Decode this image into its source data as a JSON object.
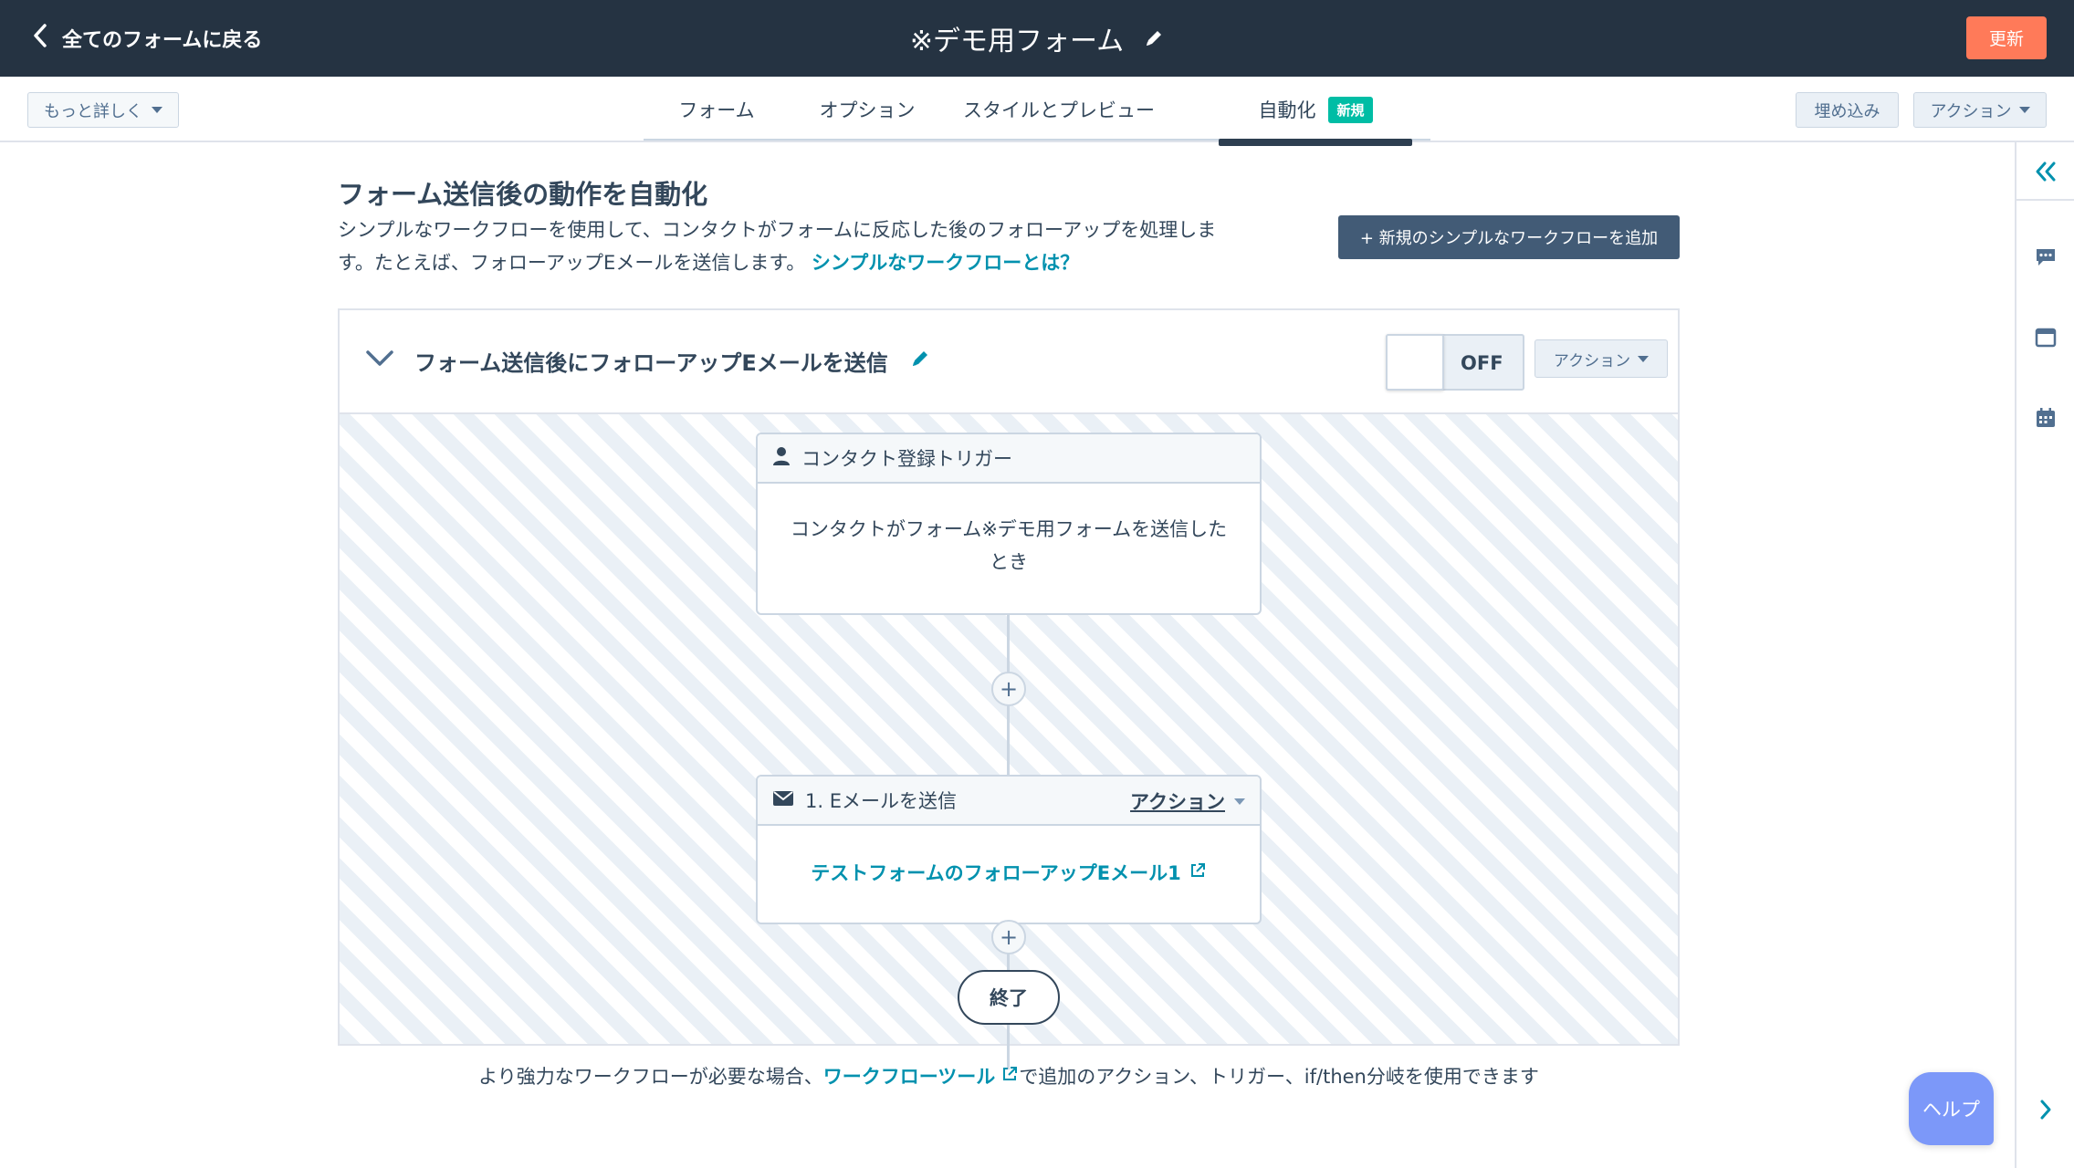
{
  "topbar": {
    "back_label": "全てのフォームに戻る",
    "form_title": "※デモ用フォーム",
    "update_label": "更新"
  },
  "navbar": {
    "more_label": "もっと詳しく",
    "tabs": [
      {
        "label": "フォーム"
      },
      {
        "label": "オプション"
      },
      {
        "label": "スタイルとプレビュー"
      },
      {
        "label": "自動化",
        "badge": "新規",
        "active": true
      }
    ],
    "embed_label": "埋め込み",
    "actions_label": "アクション"
  },
  "main": {
    "heading": "フォーム送信後の動作を自動化",
    "description": "シンプルなワークフローを使用して、コンタクトがフォームに反応した後のフォローアップを処理します。たとえば、フォローアップEメールを送信します。",
    "description_link": "シンプルなワークフローとは？",
    "add_workflow_label": "+ 新規のシンプルなワークフローを追加"
  },
  "workflow": {
    "title": "フォーム送信後にフォローアップEメールを送信",
    "toggle_state": "OFF",
    "actions_label": "アクション",
    "trigger": {
      "header": "コンタクト登録トリガー",
      "body_line1": "コンタクトがフォーム※デモ用フォームを送信した",
      "body_line2": "とき"
    },
    "step1": {
      "header": "1. Eメールを送信",
      "action_label": "アクション",
      "email_link": "テストフォームのフォローアップEメール1"
    },
    "plus_label": "+",
    "end_label": "終了"
  },
  "footer": {
    "prefix": "より強力なワークフローが必要な場合、",
    "link": "ワークフローツール",
    "suffix": "で追加のアクション、トリガー、if/then分岐を使用できます"
  },
  "help_label": "ヘルプ",
  "colors": {
    "topbar_bg": "#253342",
    "update_btn": "#ff7a59",
    "link": "#0091ae",
    "badge_new": "#00bda5",
    "help_btn": "#7c98f9"
  }
}
